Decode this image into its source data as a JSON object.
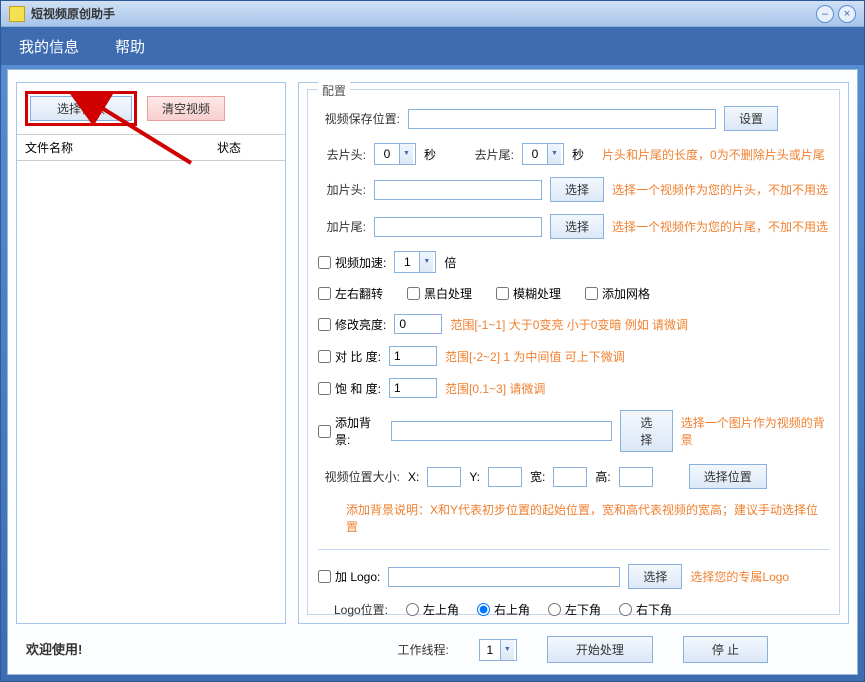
{
  "window": {
    "title": "短视频原创助手"
  },
  "menu": {
    "info": "我的信息",
    "help": "帮助"
  },
  "left": {
    "select_video": "选择视频",
    "clear_video": "清空视频",
    "col_filename": "文件名称",
    "col_status": "状态"
  },
  "footer": "欢迎使用!",
  "config": {
    "legend": "配置",
    "save_path_label": "视频保存位置:",
    "set_btn": "设置",
    "trim_head_label": "去片头:",
    "trim_head_val": "0",
    "sec": "秒",
    "trim_tail_label": "去片尾:",
    "trim_tail_val": "0",
    "trim_hint": "片头和片尾的长度，0为不删除片头或片尾",
    "add_head_label": "加片头:",
    "choose": "选择",
    "add_head_hint": "选择一个视频作为您的片头，不加不用选",
    "add_tail_label": "加片尾:",
    "add_tail_hint": "选择一个视频作为您的片尾，不加不用选",
    "speed_label": "视频加速:",
    "speed_val": "1",
    "speed_unit": "倍",
    "flip_lr": "左右翻转",
    "bw": "黑白处理",
    "blur": "模糊处理",
    "grid": "添加网格",
    "brightness_label": "修改亮度:",
    "brightness_val": "0",
    "brightness_hint": "范围[-1~1]   大于0变亮 小于0变暗  例如 请微调",
    "contrast_label": "对 比  度:",
    "contrast_val": "1",
    "contrast_hint": "范围[-2~2]  1 为中间值  可上下微调",
    "saturation_label": "饱 和  度:",
    "saturation_val": "1",
    "saturation_hint": "范围[0.1~3]   请微调",
    "add_bg_label": "添加背景:",
    "add_bg_hint": "选择一个图片作为视频的背景",
    "pos_size_label": "视频位置大小:",
    "x": "X:",
    "y": "Y:",
    "w": "宽:",
    "h": "高:",
    "choose_pos": "选择位置",
    "bg_desc": "添加背景说明：X和Y代表初步位置的起始位置，宽和高代表视频的宽高；建议手动选择位置",
    "add_logo_label": "加 Logo:",
    "add_logo_hint": "选择您的专属Logo",
    "logo_pos_label": "Logo位置:",
    "pos_tl": "左上角",
    "pos_tr": "右上角",
    "pos_bl": "左下角",
    "pos_br": "右下角",
    "threads_label": "工作线程:",
    "threads_val": "1",
    "start": "开始处理",
    "stop": "停    止"
  }
}
